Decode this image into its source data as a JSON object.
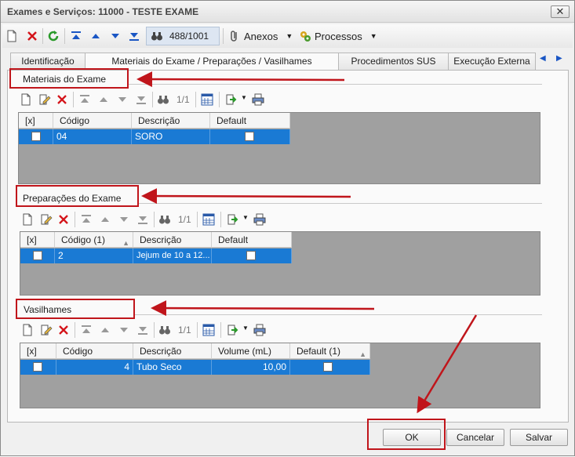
{
  "window": {
    "title": "Exames e Serviços: 11000 - TESTE EXAME",
    "close_label": "✕"
  },
  "toolbar": {
    "counter": "488/1001",
    "anexos_label": "Anexos",
    "processos_label": "Processos"
  },
  "tabs": [
    {
      "label": "Identificação"
    },
    {
      "label": "Materiais do Exame / Preparações / Vasilhames"
    },
    {
      "label": "Procedimentos SUS"
    },
    {
      "label": "Execução Externa"
    }
  ],
  "sections": {
    "materiais": {
      "title": "Materiais do Exame",
      "counter": "1/1",
      "columns": [
        "[x]",
        "Código",
        "Descrição",
        "Default"
      ],
      "rows": [
        {
          "codigo": "04",
          "descricao": "SORO"
        }
      ]
    },
    "preparacoes": {
      "title": "Preparações do Exame",
      "counter": "1/1",
      "columns": [
        "[x]",
        "Código (1)",
        "Descrição",
        "Default"
      ],
      "rows": [
        {
          "codigo": "2",
          "descricao": "Jejum de 10 a 12..."
        }
      ]
    },
    "vasilhames": {
      "title": "Vasilhames",
      "counter": "1/1",
      "columns": [
        "[x]",
        "Código",
        "Descrição",
        "Volume (mL)",
        "Default (1)"
      ],
      "rows": [
        {
          "codigo": "4",
          "descricao": "Tubo Seco",
          "volume": "10,00"
        }
      ]
    }
  },
  "buttons": {
    "ok": "OK",
    "cancelar": "Cancelar",
    "salvar": "Salvar"
  },
  "colors": {
    "selection": "#1a7ad4",
    "annotation": "#c0151b"
  }
}
